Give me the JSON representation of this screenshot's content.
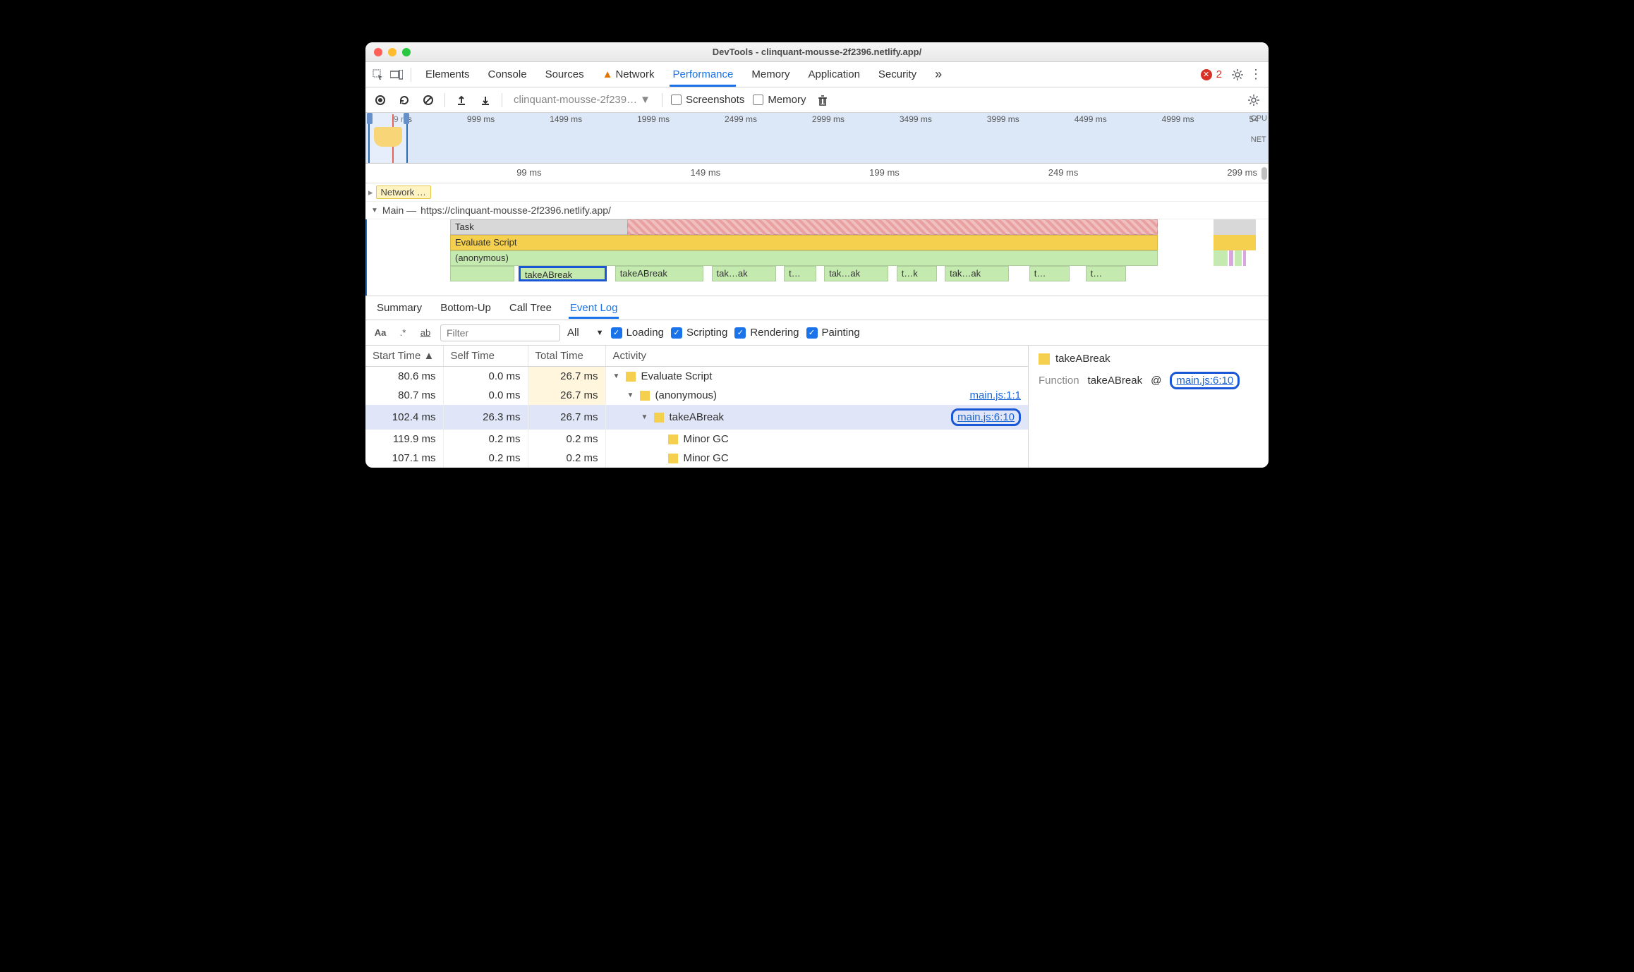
{
  "window": {
    "title": "DevTools - clinquant-mousse-2f2396.netlify.app/"
  },
  "tabs": {
    "items": [
      "Elements",
      "Console",
      "Sources",
      "Network",
      "Performance",
      "Memory",
      "Application",
      "Security"
    ],
    "network_warn": true,
    "active": "Performance",
    "overflow_glyph": "»",
    "error_count": "2"
  },
  "toolbar": {
    "profile_select": "clinquant-mousse-2f239…",
    "screenshots_label": "Screenshots",
    "memory_label": "Memory"
  },
  "overview": {
    "ticks": [
      "9 ms",
      "999 ms",
      "1499 ms",
      "1999 ms",
      "2499 ms",
      "2999 ms",
      "3499 ms",
      "3999 ms",
      "4499 ms",
      "4999 ms",
      "54"
    ],
    "cpu_label": "CPU",
    "net_label": "NET"
  },
  "timeline2": {
    "ticks": [
      "99 ms",
      "149 ms",
      "199 ms",
      "249 ms",
      "299 ms"
    ]
  },
  "networkRow": {
    "label": "Network …"
  },
  "mainThread": {
    "title_prefix": "Main —",
    "url": "https://clinquant-mousse-2f2396.netlify.app/",
    "rows": {
      "task": "Task",
      "eval": "Evaluate Script",
      "anon": "(anonymous)",
      "calls": [
        "takeABreak",
        "takeABreak",
        "tak…ak",
        "t…",
        "tak…ak",
        "t…k",
        "tak…ak",
        "t…",
        "t…"
      ]
    }
  },
  "detailTabs": {
    "items": [
      "Summary",
      "Bottom-Up",
      "Call Tree",
      "Event Log"
    ],
    "active": "Event Log"
  },
  "filters": {
    "placeholder": "Filter",
    "all_label": "All",
    "checks": [
      "Loading",
      "Scripting",
      "Rendering",
      "Painting"
    ]
  },
  "table": {
    "headers": {
      "start": "Start Time",
      "self": "Self Time",
      "total": "Total Time",
      "activity": "Activity"
    },
    "rows": [
      {
        "start": "80.6 ms",
        "self": "0.0 ms",
        "total": "26.7 ms",
        "total_hl": true,
        "indent": 0,
        "expand": "▼",
        "label": "Evaluate Script",
        "src": ""
      },
      {
        "start": "80.7 ms",
        "self": "0.0 ms",
        "total": "26.7 ms",
        "total_hl": true,
        "indent": 1,
        "expand": "▼",
        "label": "(anonymous)",
        "src": "main.js:1:1"
      },
      {
        "start": "102.4 ms",
        "self": "26.3 ms",
        "total": "26.7 ms",
        "total_hl": true,
        "indent": 2,
        "expand": "▼",
        "label": "takeABreak",
        "src": "main.js:6:10",
        "selected": true,
        "src_pill": true
      },
      {
        "start": "119.9 ms",
        "self": "0.2 ms",
        "total": "0.2 ms",
        "total_hl": false,
        "indent": 3,
        "expand": "",
        "label": "Minor GC",
        "src": ""
      },
      {
        "start": "107.1 ms",
        "self": "0.2 ms",
        "total": "0.2 ms",
        "total_hl": false,
        "indent": 3,
        "expand": "",
        "label": "Minor GC",
        "src": ""
      }
    ]
  },
  "rightPane": {
    "title": "takeABreak",
    "func_key": "Function",
    "func_name": "takeABreak",
    "at": "@",
    "src": "main.js:6:10"
  }
}
